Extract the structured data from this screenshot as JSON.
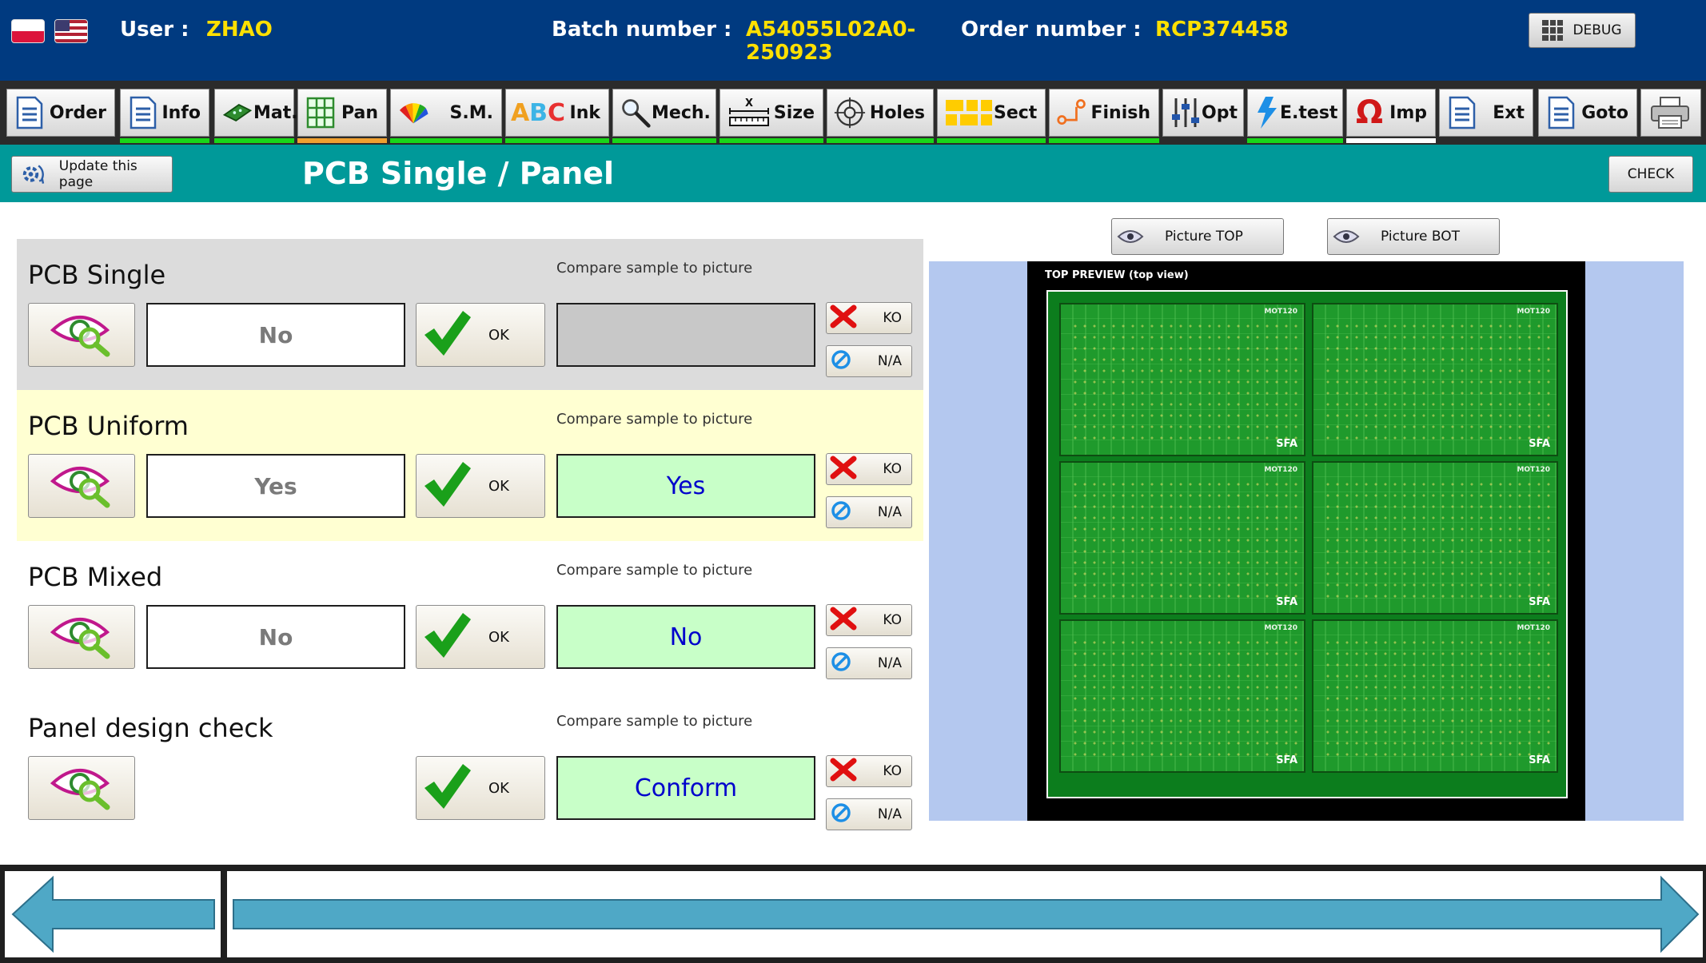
{
  "header": {
    "user_label": "User :",
    "user_value": "ZHAO",
    "batch_label": "Batch number :",
    "batch_value_line1": "A54055L02A0-",
    "batch_value_line2": "250923",
    "order_label": "Order number :",
    "order_value": "RCP374458",
    "debug_label": "DEBUG",
    "flags": [
      "poland-flag-icon",
      "usa-flag-icon"
    ]
  },
  "tabs": [
    {
      "id": "order",
      "label": "Order",
      "icon": "document-icon",
      "indicator": ""
    },
    {
      "id": "info",
      "label": "Info",
      "icon": "document-icon",
      "indicator": "#19d619"
    },
    {
      "id": "mat",
      "label": "Mat.",
      "icon": "pcb-board-icon",
      "indicator": "#19d619"
    },
    {
      "id": "pan",
      "label": "Pan",
      "icon": "grid-panel-icon",
      "indicator": "#f0a030"
    },
    {
      "id": "sm",
      "label": "S.M.",
      "icon": "color-fan-icon",
      "indicator": "#19d619"
    },
    {
      "id": "ink",
      "label": "Ink",
      "icon": "abc-letters-icon",
      "indicator": "#19d619"
    },
    {
      "id": "mech",
      "label": "Mech.",
      "icon": "magnifier-icon",
      "indicator": "#19d619"
    },
    {
      "id": "size",
      "label": "Size",
      "icon": "ruler-icon",
      "indicator": "#19d619"
    },
    {
      "id": "holes",
      "label": "Holes",
      "icon": "crosshair-icon",
      "indicator": "#19d619"
    },
    {
      "id": "sect",
      "label": "Sect",
      "icon": "section-blocks-icon",
      "indicator": "#19d619"
    },
    {
      "id": "finish",
      "label": "Finish",
      "icon": "route-icon",
      "indicator": "#19d619"
    },
    {
      "id": "opt",
      "label": "Opt",
      "icon": "sliders-icon",
      "indicator": ""
    },
    {
      "id": "etest",
      "label": "E.test",
      "icon": "lightning-icon",
      "indicator": "#19d619"
    },
    {
      "id": "imp",
      "label": "Imp",
      "icon": "omega-icon",
      "indicator": "#ffffff"
    },
    {
      "id": "ext",
      "label": "Ext",
      "icon": "document-icon",
      "indicator": ""
    },
    {
      "id": "goto",
      "label": "Goto",
      "icon": "document-icon",
      "indicator": ""
    },
    {
      "id": "print",
      "label": "",
      "icon": "printer-icon",
      "indicator": ""
    }
  ],
  "titlebar": {
    "update_label": "Update this page",
    "title": "PCB Single / Panel",
    "check_label": "CHECK"
  },
  "sections": [
    {
      "title": "PCB Single",
      "subtitle": "Compare sample to picture",
      "value": "No",
      "ok_label": "OK",
      "result": "",
      "ko_label": "KO",
      "na_label": "N/A",
      "bg": "#dcdcdc",
      "result_bg": "#c8c8c8"
    },
    {
      "title": "PCB Uniform",
      "subtitle": "Compare sample to picture",
      "value": "Yes",
      "ok_label": "OK",
      "result": "Yes",
      "ko_label": "KO",
      "na_label": "N/A",
      "bg": "#ffffd2",
      "result_bg": "#c8ffc8"
    },
    {
      "title": "PCB Mixed",
      "subtitle": "Compare sample to picture",
      "value": "No",
      "ok_label": "OK",
      "result": "No",
      "ko_label": "KO",
      "na_label": "N/A",
      "bg": "#ffffff",
      "result_bg": "#c8ffc8"
    },
    {
      "title": "Panel design check",
      "subtitle": "Compare sample to picture",
      "value": "",
      "ok_label": "OK",
      "result": "Conform",
      "ko_label": "KO",
      "na_label": "N/A",
      "bg": "#ffffff",
      "result_bg": "#c8ffc8"
    }
  ],
  "preview": {
    "picture_top_label": "Picture TOP",
    "picture_bot_label": "Picture BOT",
    "preview_title": "TOP PREVIEW (top view)",
    "board_tag": "MOT120",
    "board_logo": "SFA"
  },
  "colors": {
    "header_bg": "#003a80",
    "header_value": "#ffe000",
    "titlebar_bg": "#009999",
    "tabbar_bg": "#2b2b2b",
    "result_text": "#0000cc",
    "nav_arrow": "#4fa8c6"
  }
}
